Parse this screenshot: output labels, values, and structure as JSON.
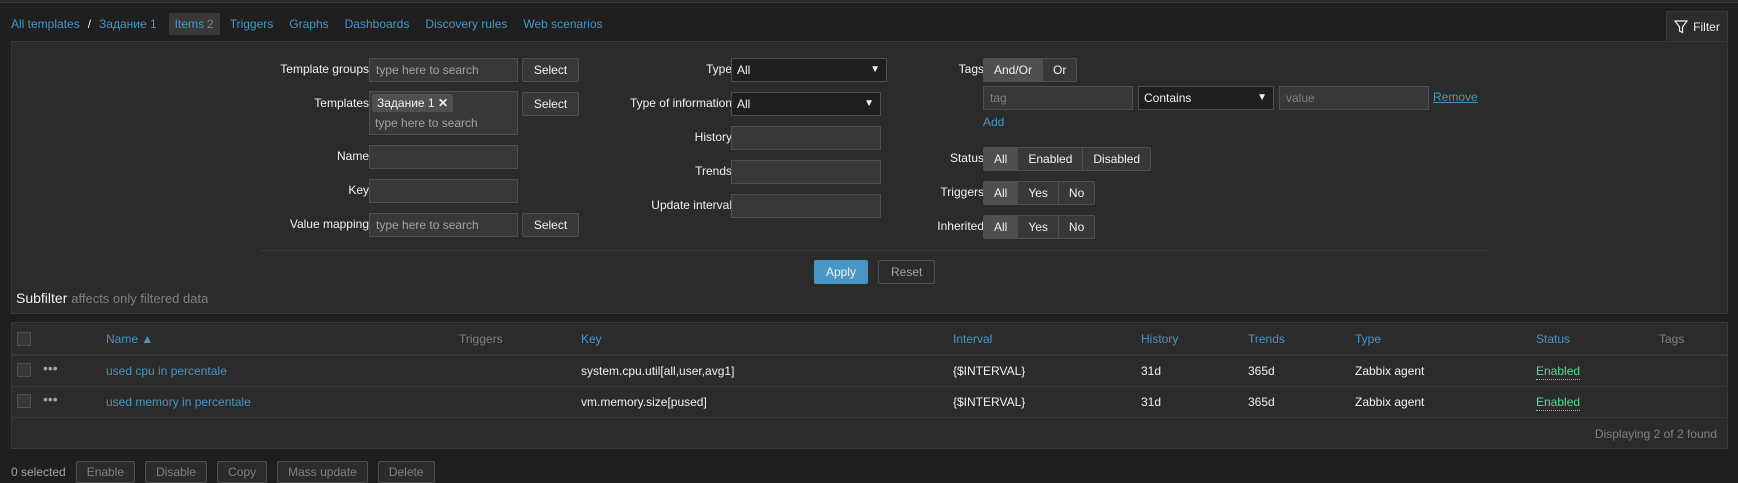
{
  "breadcrumb": {
    "all_templates": "All templates",
    "separator": "/",
    "template": "Задание 1"
  },
  "tabs": [
    {
      "label": "Items",
      "count": "2",
      "active": true
    },
    {
      "label": "Triggers"
    },
    {
      "label": "Graphs"
    },
    {
      "label": "Dashboards"
    },
    {
      "label": "Discovery rules"
    },
    {
      "label": "Web scenarios"
    }
  ],
  "filter_toggle": {
    "label": "Filter",
    "icon": "filter-funnel-icon"
  },
  "filter": {
    "template_groups": {
      "label": "Template groups",
      "placeholder": "type here to search",
      "select": "Select"
    },
    "templates": {
      "label": "Templates",
      "chip": "Задание 1",
      "placeholder": "type here to search",
      "select": "Select"
    },
    "name": {
      "label": "Name",
      "value": ""
    },
    "key": {
      "label": "Key",
      "value": ""
    },
    "value_mapping": {
      "label": "Value mapping",
      "placeholder": "type here to search",
      "select": "Select"
    },
    "type": {
      "label": "Type",
      "value": "All"
    },
    "type_of_information": {
      "label": "Type of information",
      "value": "All"
    },
    "history": {
      "label": "History",
      "value": ""
    },
    "trends": {
      "label": "Trends",
      "value": ""
    },
    "update_interval": {
      "label": "Update interval",
      "value": ""
    },
    "tags": {
      "label": "Tags",
      "andor": "And/Or",
      "or": "Or",
      "tag_placeholder": "tag",
      "operator": "Contains",
      "value_placeholder": "value",
      "remove": "Remove",
      "add": "Add"
    },
    "status": {
      "label": "Status",
      "options": [
        "All",
        "Enabled",
        "Disabled"
      ]
    },
    "triggers": {
      "label": "Triggers",
      "options": [
        "All",
        "Yes",
        "No"
      ]
    },
    "inherited": {
      "label": "Inherited",
      "options": [
        "All",
        "Yes",
        "No"
      ]
    },
    "apply": "Apply",
    "reset": "Reset"
  },
  "subfilter": {
    "title": "Subfilter",
    "note": "affects only filtered data"
  },
  "table": {
    "columns": {
      "name": "Name ▲",
      "triggers": "Triggers",
      "key": "Key",
      "interval": "Interval",
      "history": "History",
      "trends": "Trends",
      "type": "Type",
      "status": "Status",
      "tags": "Tags"
    },
    "rows": [
      {
        "name": "used cpu in percentale",
        "key": "system.cpu.util[all,user,avg1]",
        "interval": "{$INTERVAL}",
        "history": "31d",
        "trends": "365d",
        "type": "Zabbix agent",
        "status": "Enabled"
      },
      {
        "name": "used memory in percentale",
        "key": "vm.memory.size[pused]",
        "interval": "{$INTERVAL}",
        "history": "31d",
        "trends": "365d",
        "type": "Zabbix agent",
        "status": "Enabled"
      }
    ],
    "footer": "Displaying 2 of 2 found",
    "row_menu": "•••"
  },
  "bottom": {
    "selected": "0 selected",
    "buttons": [
      "Enable",
      "Disable",
      "Copy",
      "Mass update",
      "Delete"
    ]
  }
}
